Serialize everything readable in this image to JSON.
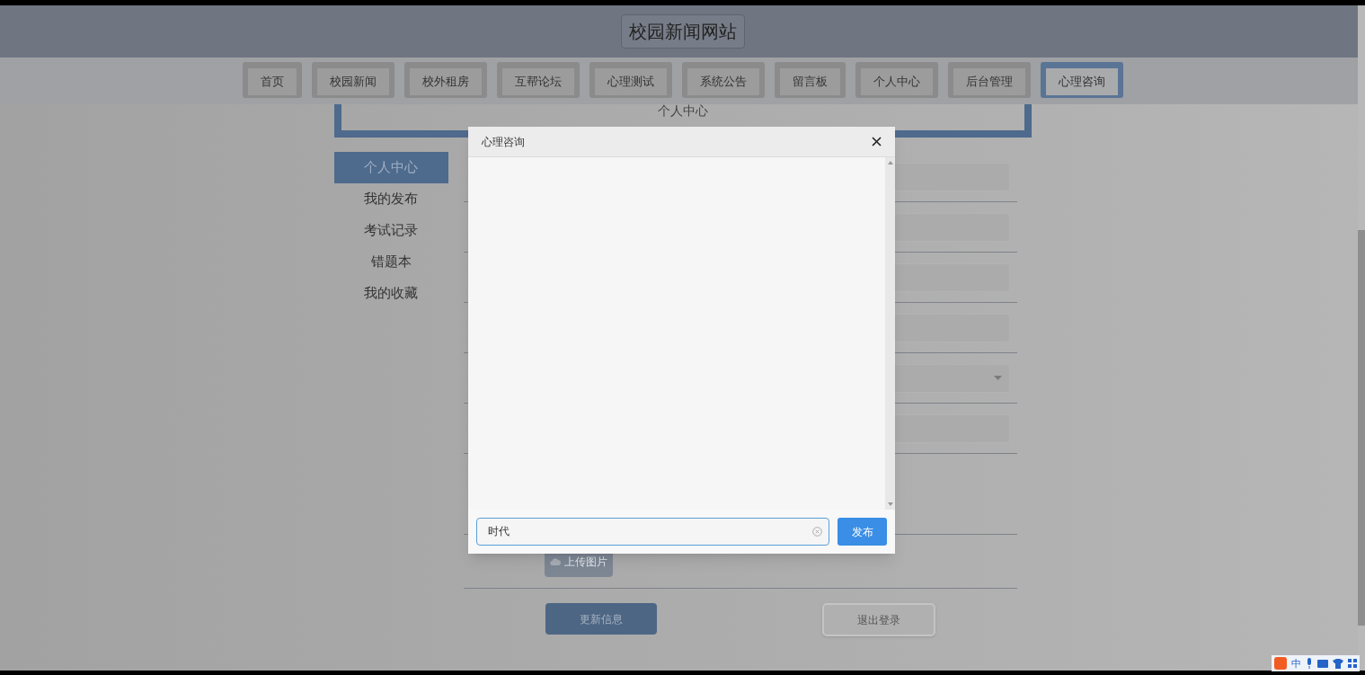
{
  "site_title": "校园新闻网站",
  "nav": [
    {
      "label": "首页",
      "selected": false
    },
    {
      "label": "校园新闻",
      "selected": false
    },
    {
      "label": "校外租房",
      "selected": false
    },
    {
      "label": "互帮论坛",
      "selected": false
    },
    {
      "label": "心理测试",
      "selected": false
    },
    {
      "label": "系统公告",
      "selected": false
    },
    {
      "label": "留言板",
      "selected": false
    },
    {
      "label": "个人中心",
      "selected": false
    },
    {
      "label": "后台管理",
      "selected": false
    },
    {
      "label": "心理咨询",
      "selected": true
    }
  ],
  "panel_title": "个人中心",
  "sidebar": [
    {
      "label": "个人中心",
      "selected": true
    },
    {
      "label": "我的发布",
      "selected": false
    },
    {
      "label": "考试记录",
      "selected": false
    },
    {
      "label": "错题本",
      "selected": false
    },
    {
      "label": "我的收藏",
      "selected": false
    }
  ],
  "form_rows": [
    {
      "kind": "input"
    },
    {
      "kind": "input"
    },
    {
      "kind": "input"
    },
    {
      "kind": "input"
    },
    {
      "kind": "select"
    },
    {
      "kind": "input"
    },
    {
      "kind": "blank"
    },
    {
      "kind": "upload",
      "label": "上传图片"
    }
  ],
  "form_buttons": [
    {
      "label": "更新信息",
      "kind": "primary"
    },
    {
      "label": "退出登录",
      "kind": "plain"
    }
  ],
  "dialog": {
    "title": "心理咨询",
    "input_value": "时代",
    "send_button": "发布"
  },
  "ime_bar": {
    "mode": "中"
  }
}
